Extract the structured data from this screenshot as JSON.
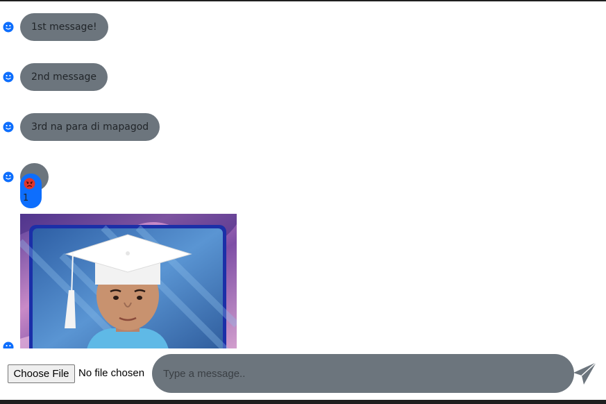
{
  "messages": [
    {
      "text": "1st message!"
    },
    {
      "text": "2nd message"
    },
    {
      "text": "3rd na para di mapagod"
    },
    {
      "text": ""
    }
  ],
  "reaction": {
    "emoji": "angry-face-icon",
    "count": "1"
  },
  "composer": {
    "file_button": "Choose File",
    "file_status": "No file chosen",
    "placeholder": "Type a message.."
  },
  "colors": {
    "bubble": "#6c757d",
    "avatar": "#0d6efd",
    "reaction": "#0d6efd",
    "angry": "#e0352b"
  }
}
